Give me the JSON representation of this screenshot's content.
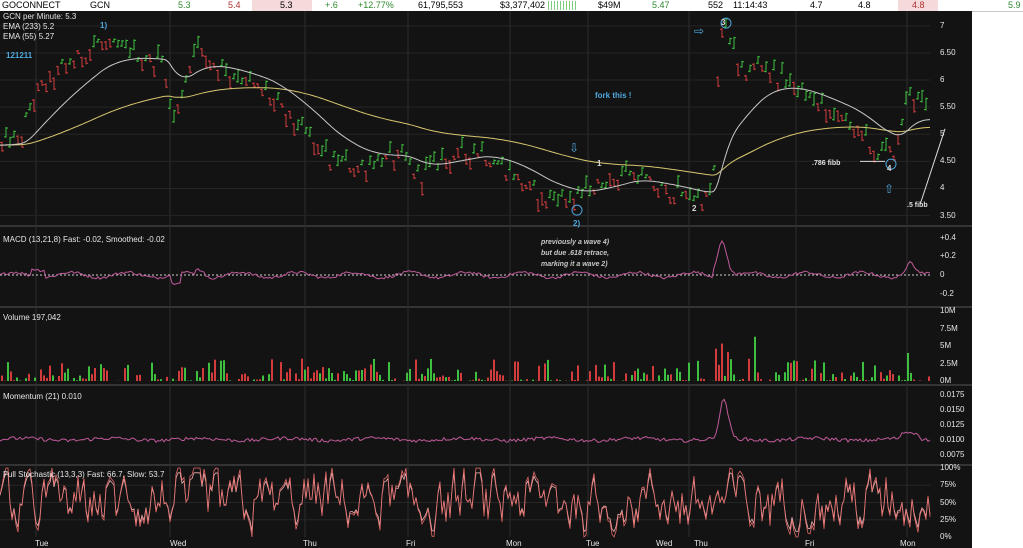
{
  "ticker": {
    "company": "GOCONNECT",
    "symbol": "GCN",
    "bid": "5.3",
    "ask": "5.4",
    "last": "5.3",
    "change": "+.6",
    "change_pct": "+12.77%",
    "volume": "61,795,553",
    "value": "$3,377,402",
    "market_cap": "$49M",
    "open": "5.47",
    "trades": "552",
    "time": "11:14:43",
    "low": "4.7",
    "high": "4.8",
    "prev": "4.8",
    "extra": "5.9"
  },
  "panels": {
    "price_label": "GCN per Minute: 5.3",
    "ema1_label": "EMA (233) 5.2",
    "ema2_label": "EMA (55) 5.27",
    "watermark": "121211",
    "macd_label": "MACD (13,21,8) Fast: -0.02, Smoothed: -0.02",
    "volume_label": "Volume 197,042",
    "momentum_label": "Momentum (21) 0.010",
    "stoch_label": "Full Stochastic (13,3,3) Fast: 66.7, Slow: 53.7"
  },
  "axes": {
    "price_ticks": [
      "7",
      "6.50",
      "6",
      "5.50",
      "5",
      "4.50",
      "4",
      "3.50"
    ],
    "macd_ticks": [
      "+0.4",
      "+0.2",
      "0",
      "-0.2"
    ],
    "volume_ticks": [
      "10M",
      "7.5M",
      "5M",
      "2.5M",
      "0M"
    ],
    "momentum_ticks": [
      "0.0175",
      "0.0150",
      "0.0125",
      "0.0100",
      "0.0075"
    ],
    "stoch_ticks": [
      "100%",
      "75%",
      "50%",
      "25%",
      "0%"
    ],
    "days": [
      "Tue",
      "Wed",
      "Thu",
      "Fri",
      "Mon",
      "Tue",
      "Wed",
      "Thu",
      "Fri",
      "Mon"
    ]
  },
  "annotations": {
    "wave1_top": "1)",
    "wave2_left": "2)",
    "wave1_right": "1",
    "wave2_right": "2",
    "wave3": "3",
    "wave4": "4",
    "fork": "fork this !",
    "note_line1": "previously a wave 4)",
    "note_line2": "but due .618 retrace,",
    "note_line3": "marking it a wave 2)",
    "fib_786": ".786 fibb",
    "fib_5": ".5 fibb"
  },
  "colors": {
    "background": "#131313",
    "up": "#3fbf3f",
    "down": "#d23c3c",
    "ema_long": "#d8c870",
    "ema_short": "#c8c8c8",
    "indicator": "#c05a9a",
    "annotation": "#4ea8de",
    "change_pos": "#2e8b2e"
  },
  "chart_data": {
    "type": "line",
    "x": [
      "Tue",
      "Wed",
      "Thu",
      "Fri",
      "Mon",
      "Tue",
      "Wed",
      "Thu",
      "Fri",
      "Mon"
    ],
    "series": [
      {
        "name": "GCN per Minute",
        "values": [
          5.0,
          6.3,
          5.5,
          4.5,
          4.6,
          3.9,
          4.2,
          7.0,
          5.6,
          5.3
        ]
      },
      {
        "name": "EMA (233)",
        "values": [
          4.6,
          5.8,
          5.6,
          4.9,
          4.6,
          4.2,
          4.1,
          5.2,
          5.3,
          5.2
        ]
      },
      {
        "name": "EMA (55)",
        "values": [
          4.9,
          6.1,
          5.6,
          4.6,
          4.7,
          4.0,
          4.0,
          6.0,
          5.5,
          5.27
        ]
      }
    ],
    "ylim": [
      3.4,
      7.2
    ],
    "panels": [
      {
        "name": "MACD (13,21,8)",
        "ylim": [
          -0.3,
          0.45
        ],
        "fast": -0.02,
        "smoothed": -0.02
      },
      {
        "name": "Volume",
        "ylim": [
          0,
          10000000
        ],
        "value": 197042
      },
      {
        "name": "Momentum (21)",
        "ylim": [
          0.0065,
          0.0185
        ],
        "value": 0.01
      },
      {
        "name": "Full Stochastic (13,3,3)",
        "ylim": [
          0,
          100
        ],
        "fast": 66.7,
        "slow": 53.7
      }
    ]
  }
}
